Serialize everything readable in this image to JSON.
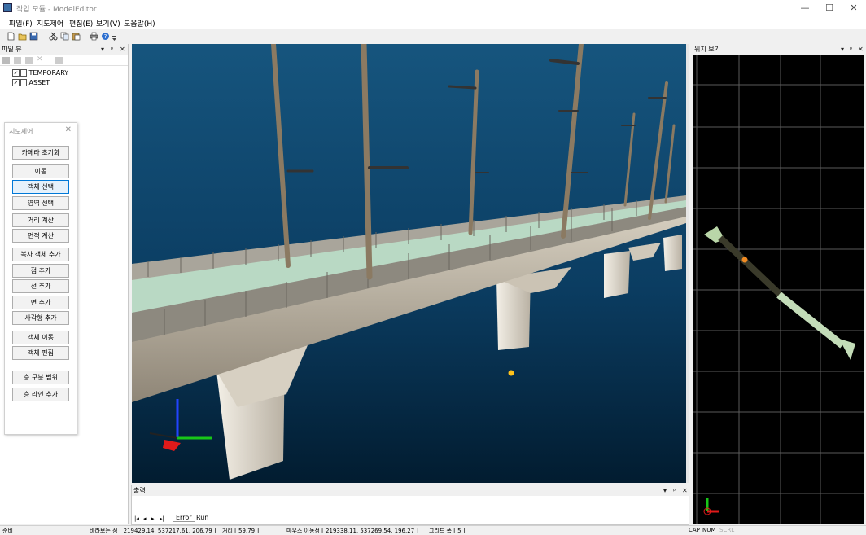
{
  "window": {
    "title": "작업 모듈 - ModelEditor",
    "minimize": "—",
    "maximize": "☐",
    "close": "✕"
  },
  "menu": [
    "파일(F)",
    "지도제어",
    "편집(E)",
    "보기(V)",
    "도움말(H)"
  ],
  "toolbar": {
    "icons": [
      "new-file-icon",
      "open-folder-icon",
      "save-icon",
      "cut-icon",
      "copy-icon",
      "paste-icon",
      "print-icon",
      "help-icon",
      "overflow-icon"
    ]
  },
  "file_view": {
    "title": "파일 뷰",
    "controls": [
      "▾",
      "ᵖ",
      "✕"
    ],
    "items": [
      {
        "label": "TEMPORARY",
        "checked": true
      },
      {
        "label": "ASSET",
        "checked": true
      }
    ]
  },
  "map_control": {
    "title": "지도제어",
    "close": "✕",
    "buttons": [
      {
        "label": "카메라 초기화"
      },
      {
        "label": "이동"
      },
      {
        "label": "객체 선택",
        "selected": true
      },
      {
        "label": "영역 선택"
      },
      {
        "label": "거리 계산"
      },
      {
        "label": "면적 계산"
      },
      {
        "label": "복사 객체 추가"
      },
      {
        "label": "점 추가"
      },
      {
        "label": "선 추가"
      },
      {
        "label": "면 추가"
      },
      {
        "label": "사각형 추가"
      },
      {
        "label": "객체 이동"
      },
      {
        "label": "객체 편집"
      },
      {
        "label": "층 구분 범위"
      },
      {
        "label": "층 라인 추가"
      }
    ]
  },
  "output": {
    "title": "출력",
    "controls": [
      "▾",
      "ᵖ",
      "✕"
    ],
    "nav": [
      "|◂",
      "◂",
      "▸",
      "▸|"
    ],
    "tabs": [
      "Error",
      "Run"
    ]
  },
  "position_view": {
    "title": "위치 보기",
    "controls": [
      "▾",
      "ᵖ",
      "✕"
    ]
  },
  "status": {
    "ready": "준비",
    "view_point": "바라보는 점 [ 219429.14, 537217.61, 206.79 ]",
    "distance": "거리 [ 59.79 ]",
    "mouse_point": "마우스 이동점 [ 219338.11, 537269.54, 196.27 ]",
    "grid": "그리드 폭 [ 5 ]",
    "cap": "CAP",
    "num": "NUM",
    "scrl": "SCRL"
  },
  "colors": {
    "accent": "#0078d7",
    "sky_top": "#16557e",
    "sky_bottom": "#021c30",
    "deck": "#b9d9c4"
  }
}
